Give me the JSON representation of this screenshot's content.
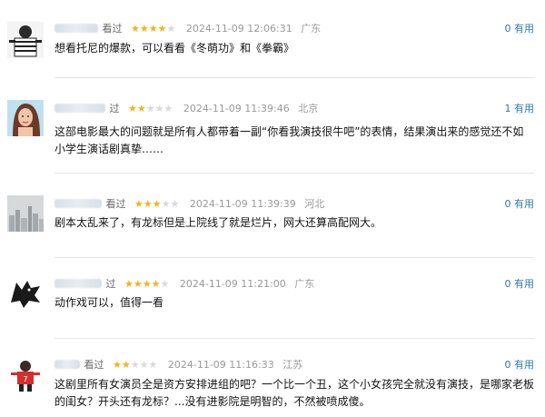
{
  "reviews": [
    {
      "user_suffix": "",
      "watched": "看过",
      "rating": 4,
      "time": "2024-11-09 12:06:31",
      "location": "广东",
      "useful": "0 有用",
      "content": "想看托尼的爆款，可以看看《冬萌功》和《拳霸》",
      "avatar": "striped-shirt-avatar"
    },
    {
      "user_suffix": "",
      "watched": "过",
      "rating": 2,
      "time": "2024-11-09 11:39:46",
      "location": "北京",
      "useful": "1 有用",
      "content": "这部电影最大的问题就是所有人都带着一副“你看我演技很牛吧”的表情，结果演出来的感觉还不如小学生演话剧真挚……",
      "avatar": "woman-portrait-avatar"
    },
    {
      "user_suffix": "",
      "watched": "看过",
      "rating": 3,
      "time": "2024-11-09 11:39:39",
      "location": "河北",
      "useful": "0 有用",
      "content": "剧本太乱来了，有龙标但是上院线了就是烂片，网大还算高配网大。",
      "avatar": "foggy-city-avatar"
    },
    {
      "user_suffix": "",
      "watched": "过",
      "rating": 4,
      "time": "2024-11-09 11:21:00",
      "location": "广东",
      "useful": "0 有用",
      "content": "动作戏可以，值得一看",
      "avatar": "wolf-sigil-avatar"
    },
    {
      "user_suffix": "",
      "watched": "看过",
      "rating": 2,
      "time": "2024-11-09 11:16:33",
      "location": "江苏",
      "useful": "0 有用",
      "content": "这剧里所有女演员全是资方安排进组的吧？一个比一个丑，这个小女孩完全就没有演技，是哪家老板的闺女？开头还有龙标？...没有进影院是明智的，不然被喷成傻。",
      "avatar": "soccer-kid-avatar"
    }
  ],
  "colors": {
    "star_on": "#f5b21b",
    "star_off": "#d9d9d9",
    "useful": "#3377aa",
    "meta": "#999999"
  }
}
